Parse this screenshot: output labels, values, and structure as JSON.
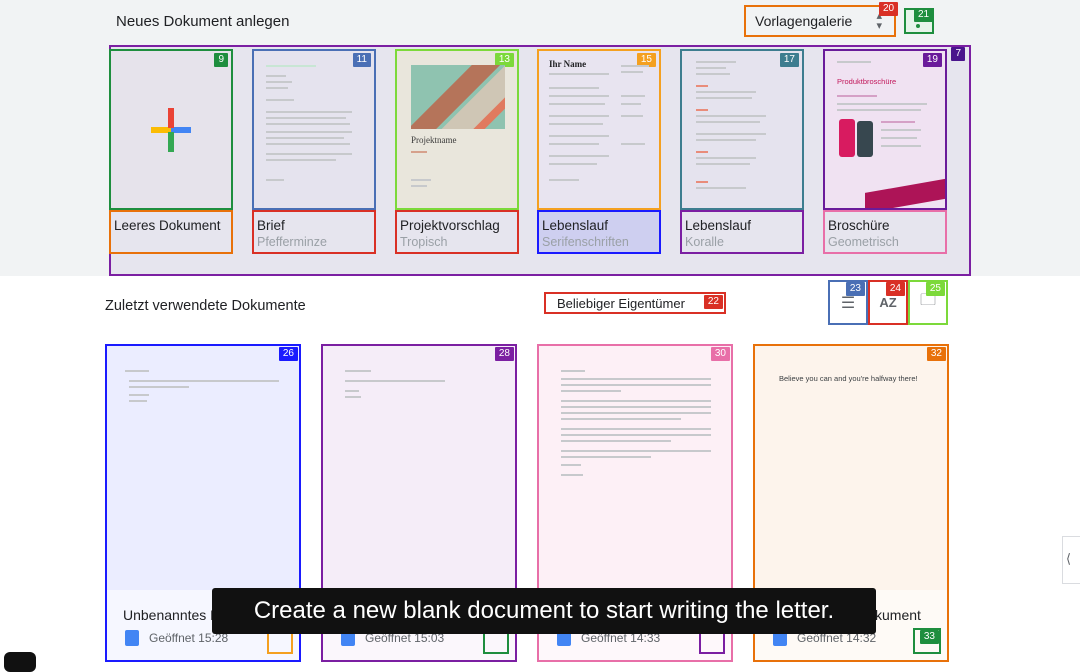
{
  "top": {
    "section_title": "Neues Dokument anlegen",
    "gallery_label": "Vorlagengalerie",
    "gallery_badge": "20",
    "more_badge": "21",
    "strip_badge": "7"
  },
  "templates": [
    {
      "name": "Leeres Dokument",
      "sub": "",
      "badge": "9",
      "border": "#1e8e3e",
      "label_border": "#e8710a",
      "badge_color": "#1e8e3e"
    },
    {
      "name": "Brief",
      "sub": "Pfefferminze",
      "badge": "11",
      "border": "#4a6fb5",
      "label_border": "#d93025",
      "badge_color": "#4a6fb5"
    },
    {
      "name": "Projektvorschlag",
      "sub": "Tropisch",
      "badge": "13",
      "border": "#7cd93a",
      "label_border": "#d93025",
      "badge_color": "#7cd93a",
      "thumb_title": "Projektname"
    },
    {
      "name": "Lebenslauf",
      "sub": "Serifenschriften",
      "badge": "15",
      "border": "#f4a020",
      "label_border": "#1a1aff",
      "badge_color": "#f4a020",
      "thumb_title": "Ihr Name"
    },
    {
      "name": "Lebenslauf",
      "sub": "Koralle",
      "badge": "17",
      "border": "#3d7d8f",
      "label_border": "#7b1fa2",
      "badge_color": "#3d7d8f"
    },
    {
      "name": "Broschüre",
      "sub": "Geometrisch",
      "badge": "19",
      "border": "#6a1b9a",
      "label_border": "#e86fa8",
      "badge_color": "#6a1b9a",
      "thumb_title": "Produktbroschüre"
    }
  ],
  "recent": {
    "section_title": "Zuletzt verwendete Dokumente",
    "owner_label": "Beliebiger Eigentümer",
    "owner_badge": "22",
    "list_badge": "23",
    "sort_badge": "24",
    "folder_badge": "25",
    "sort_label": "AZ"
  },
  "docs": [
    {
      "name": "Unbenanntes D",
      "opened": "Geöffnet 15:28",
      "badge": "26",
      "border": "#1a1aff",
      "tint": "rgba(63,81,255,0.10)",
      "menu_color": "#f4a020"
    },
    {
      "name": "",
      "opened": "Geöffnet 15:03",
      "badge": "28",
      "border": "#7b1fa2",
      "tint": "rgba(123,31,162,0.08)",
      "menu_color": "#1e8e3e"
    },
    {
      "name": "",
      "opened": "Geöffnet 14:33",
      "badge": "30",
      "border": "#e86fa8",
      "tint": "rgba(232,111,168,0.10)",
      "menu_color": "#7b1fa2"
    },
    {
      "name": "kument",
      "opened": "Geöffnet 14:32",
      "badge": "32",
      "border": "#e8710a",
      "tint": "rgba(232,113,10,0.08)",
      "menu_color": "#1e8e3e",
      "menu_badge": "33",
      "preview": "Believe you can and you're halfway there!"
    }
  ],
  "caption": "Create a new blank document to start writing the letter.",
  "colors": {
    "accent_blue": "#4285f4",
    "accent_red": "#ea4335",
    "accent_yellow": "#fbbc04",
    "accent_green": "#34a853"
  }
}
